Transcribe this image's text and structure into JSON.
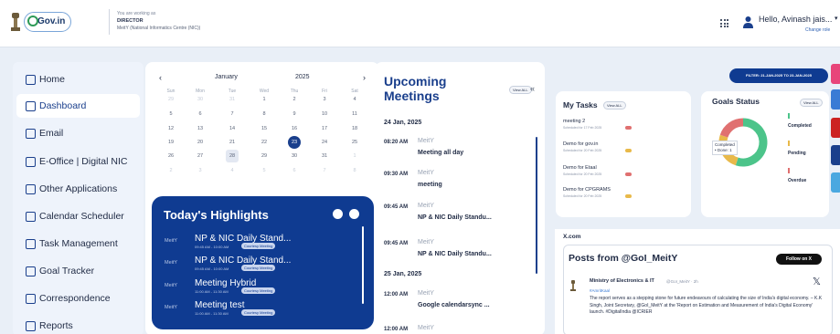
{
  "header": {
    "working_label": "You are working as",
    "role": "DIRECTOR",
    "org": "MeitY (National Informatics Centre (NIC))",
    "logo_text": "Gov.in",
    "greeting": "Hello, Avinash jais...",
    "change_role": "Change role"
  },
  "sidebar": {
    "items": [
      {
        "label": "Home",
        "icon": "home-icon"
      },
      {
        "label": "Dashboard",
        "icon": "dashboard-icon"
      },
      {
        "label": "Email",
        "icon": "mail-icon"
      },
      {
        "label": "E-Office | Digital NIC",
        "icon": "folder-icon"
      },
      {
        "label": "Other Applications",
        "icon": "window-icon"
      },
      {
        "label": "Calendar Scheduler",
        "icon": "calendar-icon"
      },
      {
        "label": "Task Management",
        "icon": "clipboard-icon"
      },
      {
        "label": "Goal Tracker",
        "icon": "target-icon"
      },
      {
        "label": "Correspondence",
        "icon": "document-icon"
      },
      {
        "label": "Reports",
        "icon": "report-icon"
      }
    ]
  },
  "calendar": {
    "prev": "‹",
    "next": "›",
    "month": "January",
    "year": "2025",
    "weekdays": [
      "Sun",
      "Mon",
      "Tue",
      "Wed",
      "Thu",
      "Fri",
      "Sat"
    ],
    "weeks": [
      [
        "29",
        "30",
        "31",
        "1",
        "2",
        "3",
        "4"
      ],
      [
        "5",
        "6",
        "7",
        "8",
        "9",
        "10",
        "11"
      ],
      [
        "12",
        "13",
        "14",
        "15",
        "16",
        "17",
        "18"
      ],
      [
        "19",
        "20",
        "21",
        "22",
        "23",
        "24",
        "25"
      ],
      [
        "26",
        "27",
        "28",
        "29",
        "30",
        "31",
        "1"
      ],
      [
        "2",
        "3",
        "4",
        "5",
        "6",
        "7",
        "8"
      ]
    ],
    "today": "23",
    "selected": "28"
  },
  "highlights": {
    "title": "Today's Highlights",
    "items": [
      {
        "org": "MeitY",
        "name": "NP & NIC Daily Stand...",
        "time": "09:45 AM - 10:00 AM",
        "badge": "Courtesy Meeting"
      },
      {
        "org": "MeitY",
        "name": "NP & NIC Daily Stand...",
        "time": "09:45 AM - 10:00 AM",
        "badge": "Courtesy Meeting"
      },
      {
        "org": "MeitY",
        "name": "Meeting Hybrid",
        "time": "11:00 AM - 11:30 AM",
        "badge": "Courtesy Meeting"
      },
      {
        "org": "MeitY",
        "name": "Meeting test",
        "time": "11:00 AM - 11:30 AM",
        "badge": "Courtesy Meeting"
      }
    ]
  },
  "upcoming": {
    "title": "Upcoming Meetings",
    "view_all": "View ALL",
    "collapse": "«",
    "groups": [
      {
        "date": "24 Jan, 2025",
        "meetings": [
          {
            "time": "08:20 AM",
            "org": "MeitY",
            "title": "Meeting all day"
          },
          {
            "time": "09:30 AM",
            "org": "MeitY",
            "title": "meeting"
          },
          {
            "time": "09:45 AM",
            "org": "MeitY",
            "title": "NP & NIC Daily Standu..."
          },
          {
            "time": "09:45 AM",
            "org": "MeitY",
            "title": "NP & NIC Daily Standu..."
          }
        ]
      },
      {
        "date": "25 Jan, 2025",
        "meetings": [
          {
            "time": "12:00 AM",
            "org": "MeitY",
            "title": "Google calendarsync ..."
          },
          {
            "time": "12:00 AM",
            "org": "MeitY",
            "title": ""
          }
        ]
      }
    ]
  },
  "filter": {
    "label": "FILTER: 21-JAN-2025 TO 23-JAN-2025"
  },
  "tasks": {
    "title": "My Tasks",
    "view_all": "View ALL",
    "items": [
      {
        "name": "meeting 2",
        "sub": "Scheduled for 17 Feb 2025",
        "flag_color": "#e07070"
      },
      {
        "name": "Demo for gov.in",
        "sub": "Scheduled for 20 Feb 2025",
        "flag_color": "#e8b94a"
      },
      {
        "name": "Demo for Etaal",
        "sub": "Scheduled for 20 Feb 2025",
        "flag_color": "#e07070"
      },
      {
        "name": "Demo for CPGRAMS",
        "sub": "Scheduled for 20 Feb 2025",
        "flag_color": "#e8b94a"
      }
    ]
  },
  "goals": {
    "title": "Goals Status",
    "view_all": "View ALL",
    "donut_label": "Completed",
    "donut_value": "• Done: 1",
    "legend": [
      {
        "label": "Completed",
        "color": "#4cc48a"
      },
      {
        "label": "Pending",
        "color": "#e8b94a"
      },
      {
        "label": "Overdue",
        "color": "#e07070"
      }
    ],
    "shares": [
      0.55,
      0.25,
      0.2
    ]
  },
  "x_feed": {
    "section": "X.com",
    "title": "Posts from @GoI_MeitY",
    "follow": "Follow on X",
    "post": {
      "author": "Ministry of Electronics & IT",
      "handle": "@GoI_MeitY · 2h",
      "tag": "#AmritKaal",
      "text": "The report serves as a stepping stone for future endeavours of calculating the size of India's digital economy. – K.K Singh, Joint Secretary, @GoI_MeitY at the 'Report on Estimation and Measurement of India's Digital Economy' launch. #DigitalIndia @ICRIER"
    }
  },
  "side_tabs": [
    "#e8457a",
    "#3a7bd5",
    "#cc2222",
    "#1a3f8c",
    "#4aa8e0"
  ]
}
